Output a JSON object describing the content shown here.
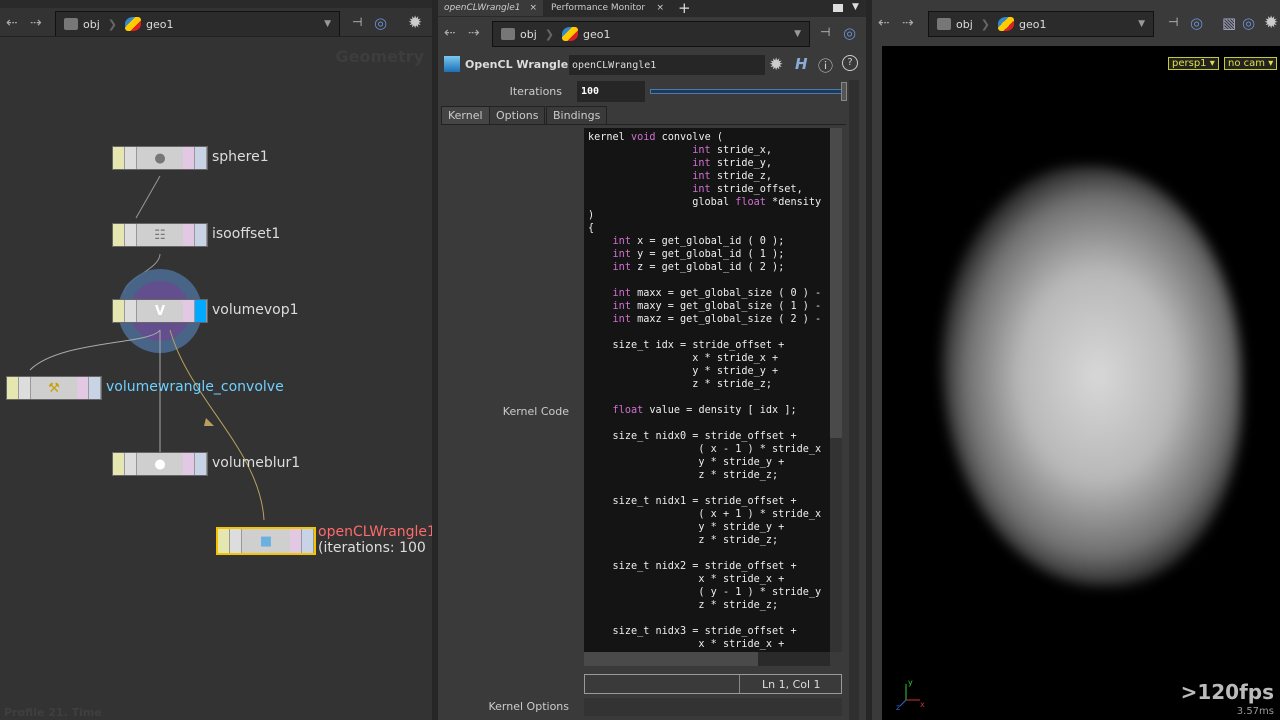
{
  "left_pane": {
    "path": [
      "obj",
      "geo1"
    ],
    "watermark": "Geometry",
    "footer": "Profile 21. Time",
    "nodes": [
      {
        "name": "sphere1",
        "icon": "sphere-icon"
      },
      {
        "name": "isooffset1",
        "icon": "isooffset-icon"
      },
      {
        "name": "volumevop1",
        "icon": "vop-icon",
        "display": true
      },
      {
        "name": "volumewrangle_convolve",
        "icon": "wrangle-icon"
      },
      {
        "name": "volumeblur1",
        "icon": "blur-icon"
      },
      {
        "name": "openCLWrangle1",
        "icon": "opencl-icon",
        "selected": true,
        "sublabel": "(iterations: 100"
      }
    ],
    "colors": {
      "selected": "#f5c400",
      "label_error": "#ff6a6a",
      "label_wrangle": "#6fd0ff"
    }
  },
  "middle_pane": {
    "tabs": [
      {
        "label": "openCLWrangle1",
        "active": true
      },
      {
        "label": "Performance Monitor"
      }
    ],
    "path": [
      "obj",
      "geo1"
    ],
    "node_type": "OpenCL Wrangle",
    "node_name": "openCLWrangle1",
    "iterations_label": "Iterations",
    "iterations_value": "100",
    "iterations_slider_fraction": 1.0,
    "param_tabs": [
      "Kernel",
      "Options",
      "Bindings"
    ],
    "kernel_code_label": "Kernel Code",
    "kernel_options_label": "Kernel Options",
    "cursor_pos": "Ln 1, Col 1",
    "code_lines": [
      "kernel void convolve (",
      "                 int stride_x,",
      "                 int stride_y,",
      "                 int stride_z,",
      "                 int stride_offset,",
      "                 global float *density",
      ")",
      "{",
      "    int x = get_global_id ( 0 );",
      "    int y = get_global_id ( 1 );",
      "    int z = get_global_id ( 2 );",
      "",
      "    int maxx = get_global_size ( 0 ) -",
      "    int maxy = get_global_size ( 1 ) -",
      "    int maxz = get_global_size ( 2 ) -",
      "",
      "    size_t idx = stride_offset +",
      "                 x * stride_x +",
      "                 y * stride_y +",
      "                 z * stride_z;",
      "",
      "    float value = density [ idx ];",
      "",
      "    size_t nidx0 = stride_offset +",
      "                  ( x - 1 ) * stride_x",
      "                  y * stride_y +",
      "                  z * stride_z;",
      "",
      "    size_t nidx1 = stride_offset +",
      "                  ( x + 1 ) * stride_x",
      "                  y * stride_y +",
      "                  z * stride_z;",
      "",
      "    size_t nidx2 = stride_offset +",
      "                  x * stride_x +",
      "                  ( y - 1 ) * stride_y",
      "                  z * stride_z;",
      "",
      "    size_t nidx3 = stride_offset +",
      "                  x * stride_x +"
    ],
    "keywords": [
      "int",
      "void",
      "float"
    ],
    "keyword_color": "#d070d0"
  },
  "viewport": {
    "path": [
      "obj",
      "geo1"
    ],
    "camera": "persp1",
    "cam_menu": "no cam",
    "fps": ">120fps",
    "frame_time": "3.57ms",
    "axes": [
      "y",
      "x",
      "z"
    ]
  }
}
